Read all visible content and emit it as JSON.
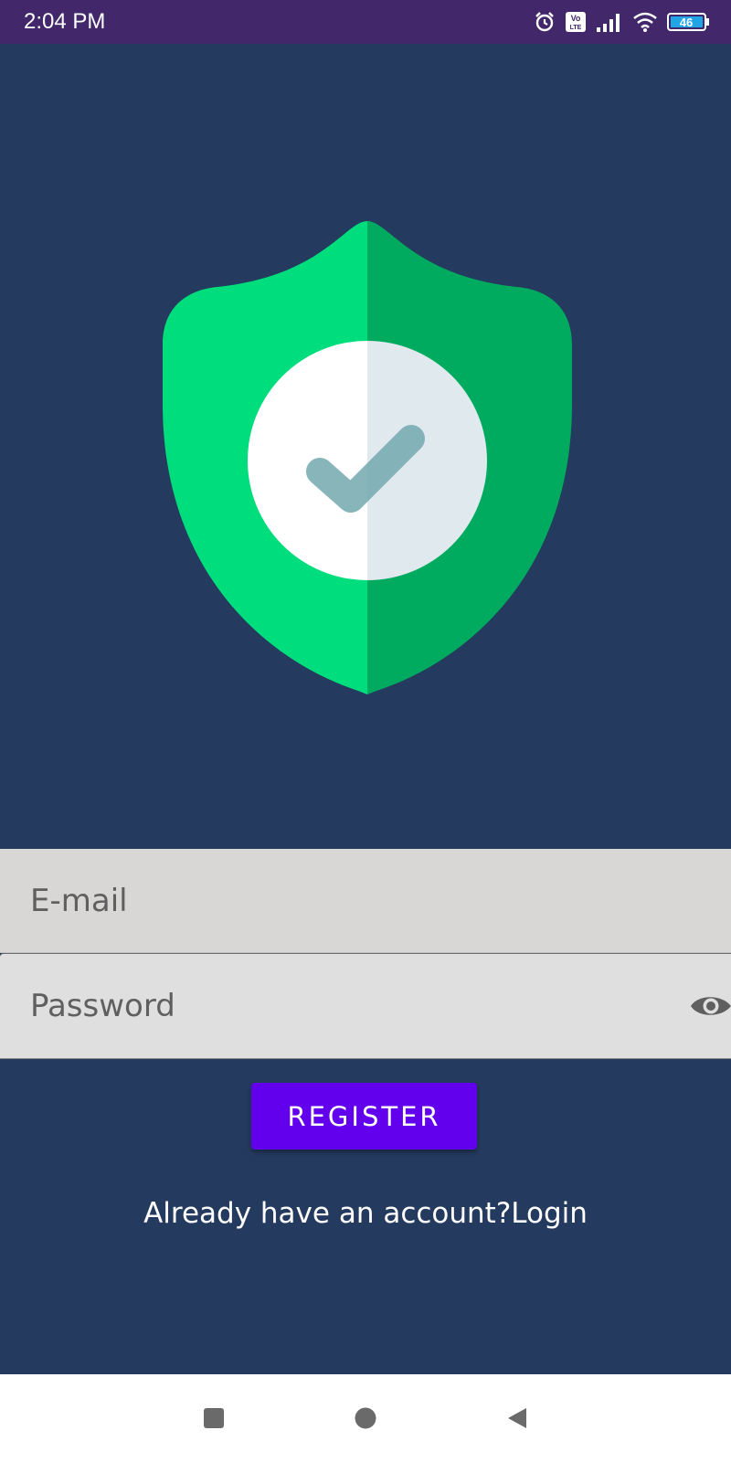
{
  "status_bar": {
    "time": "2:04 PM",
    "volte_label": "Vo LTE",
    "battery": "46",
    "icons": [
      "alarm-icon",
      "volte-icon",
      "signal-icon",
      "wifi-icon",
      "battery-icon"
    ]
  },
  "logo": {
    "icon": "shield-check-icon",
    "colors": {
      "shield_left": "#00dd7c",
      "shield_right": "#00aa5e",
      "disc_left": "#ffffff",
      "disc_right": "#e0e9ee",
      "check": "#72a8ae"
    }
  },
  "form": {
    "email_placeholder": "E-mail",
    "password_placeholder": "Password",
    "password_toggle_icon": "eye-icon",
    "register_label": "REGISTER",
    "login_prompt": "Already have an account?Login"
  },
  "nav_bar": {
    "icons": [
      "recents-square-icon",
      "home-circle-icon",
      "back-triangle-icon"
    ]
  },
  "colors": {
    "background": "#243a5e",
    "status_bar": "#42286a",
    "accent": "#6200ee"
  }
}
